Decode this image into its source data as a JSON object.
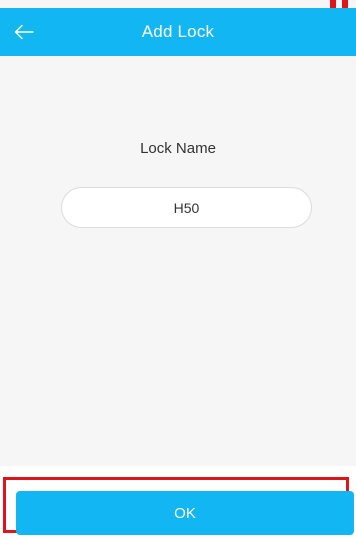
{
  "header": {
    "title": "Add Lock",
    "back_icon": "arrow-left-icon"
  },
  "form": {
    "label": "Lock Name",
    "lock_name_value": "H50"
  },
  "footer": {
    "ok_label": "OK"
  },
  "colors": {
    "accent": "#12b6f3",
    "annotation": "#e0141b",
    "background": "#f6f6f6"
  }
}
